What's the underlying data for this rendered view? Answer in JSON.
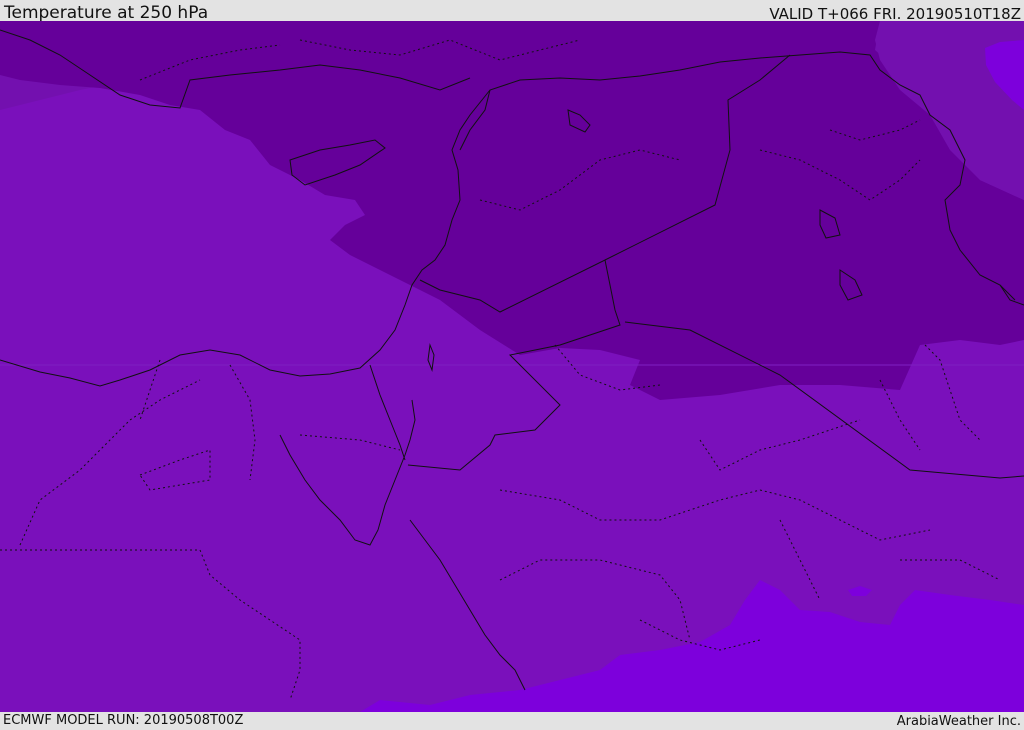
{
  "header": {
    "title": "Temperature at 250 hPa",
    "valid": "VALID T+066 FRI. 20190510T18Z"
  },
  "footer": {
    "model_run": "ECMWF MODEL RUN: 20190508T00Z",
    "credit": "ArabiaWeather Inc."
  },
  "map": {
    "fill_colors": {
      "coldest": "#65009a",
      "cold": "#7310af",
      "mid": "#7a10bb",
      "warm": "#7d00dc",
      "warmest": "#8f00ff"
    }
  }
}
